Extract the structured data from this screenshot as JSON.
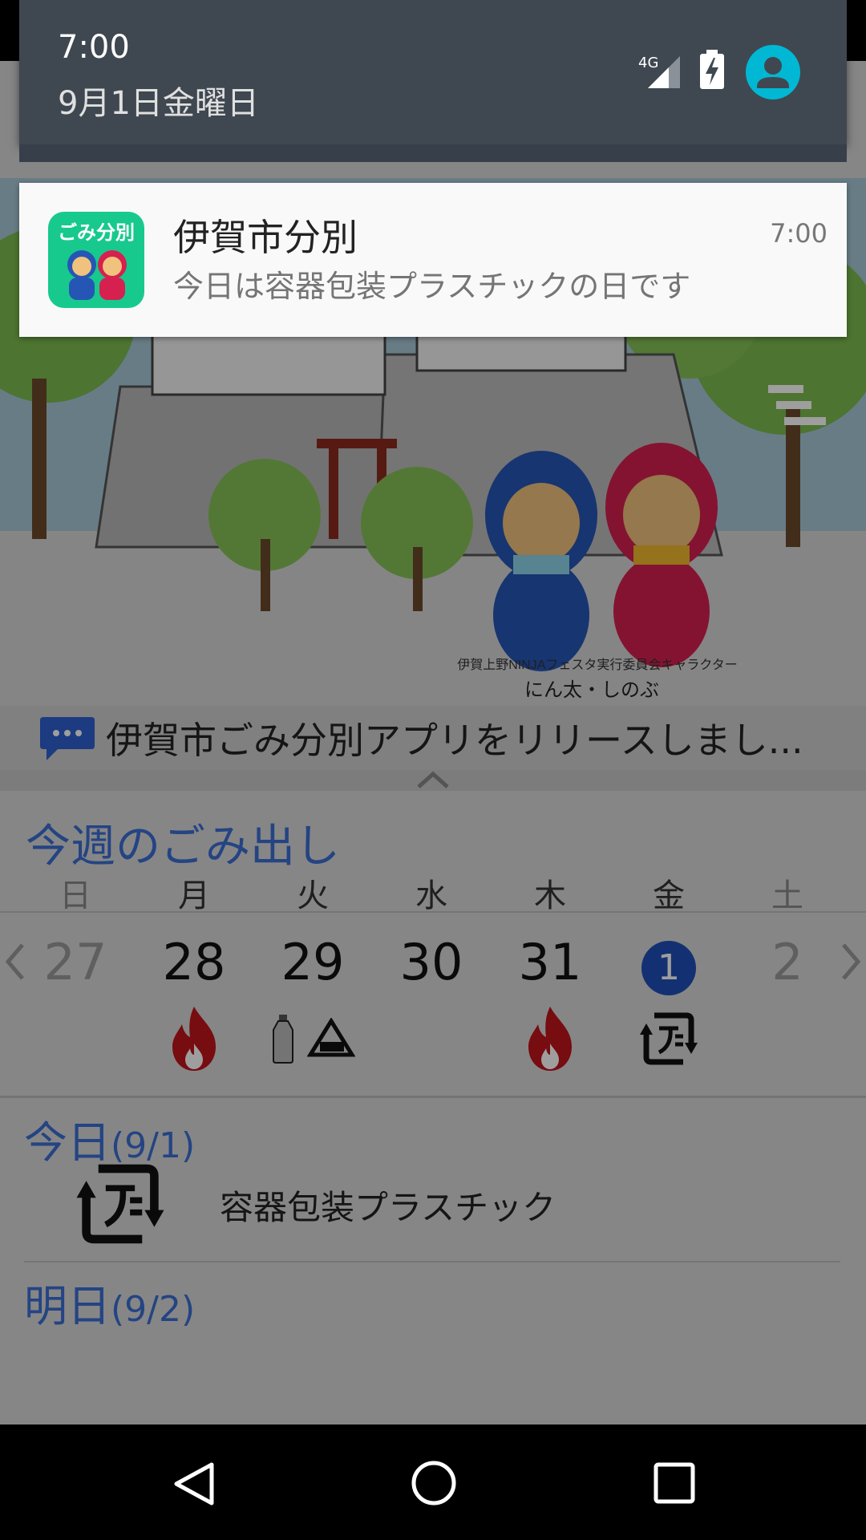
{
  "status": {
    "time": "7:00",
    "date": "9月1日金曜日",
    "network": "4G"
  },
  "notification": {
    "app_icon_label": "ごみ分別",
    "title": "伊賀市分別",
    "body": "今日は容器包装プラスチックの日です",
    "time": "7:00"
  },
  "hero": {
    "caption_small": "伊賀上野NINJAフェスタ実行委員会キャラクター",
    "caption_large": "にん太・しのぶ"
  },
  "news": {
    "text": "伊賀市ごみ分別アプリをリリースしまし..."
  },
  "week": {
    "title": "今週のごみ出し",
    "weekdays": [
      "日",
      "月",
      "火",
      "水",
      "木",
      "金",
      "土"
    ],
    "dates": [
      "27",
      "28",
      "29",
      "30",
      "31",
      "1",
      "2"
    ],
    "today_index": 5
  },
  "today": {
    "title": "今日",
    "date": "(9/1)",
    "item": "容器包装プラスチック"
  },
  "tomorrow": {
    "title": "明日",
    "date": "(9/2)"
  },
  "colors": {
    "accent": "#3b6fd4",
    "today_circle": "#1f4fb8",
    "shade": "#3f4851",
    "burnable_red": "#c0141c",
    "avatar": "#00b8d4"
  }
}
